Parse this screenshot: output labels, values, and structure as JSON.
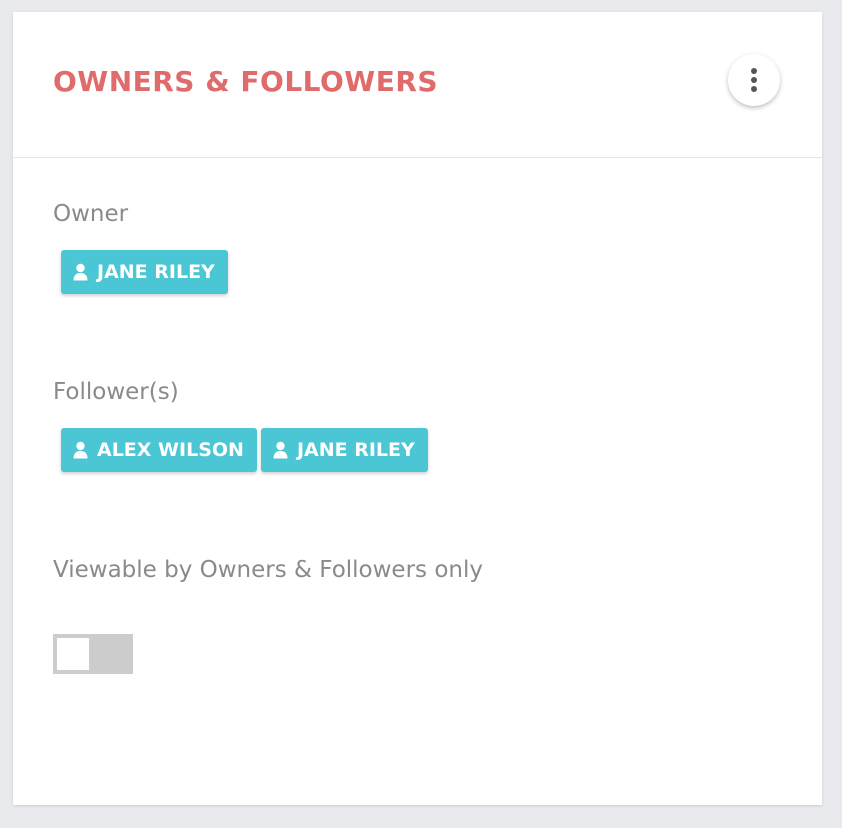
{
  "card": {
    "title": "OWNERS & FOLLOWERS",
    "more_button_icon": "more-vertical-icon"
  },
  "owner": {
    "label": "Owner",
    "chips": [
      {
        "name": "JANE RILEY",
        "icon": "user-icon"
      }
    ]
  },
  "followers": {
    "label": "Follower(s)",
    "chips": [
      {
        "name": "ALEX WILSON",
        "icon": "user-icon"
      },
      {
        "name": "JANE RILEY",
        "icon": "user-icon"
      }
    ]
  },
  "visibility": {
    "label": "Viewable by Owners & Followers only",
    "toggle_on": false
  },
  "colors": {
    "title": "#e06b6b",
    "chip": "#4bc6d4",
    "toggle_off": "#cccccc",
    "label": "#8a8a8a"
  }
}
